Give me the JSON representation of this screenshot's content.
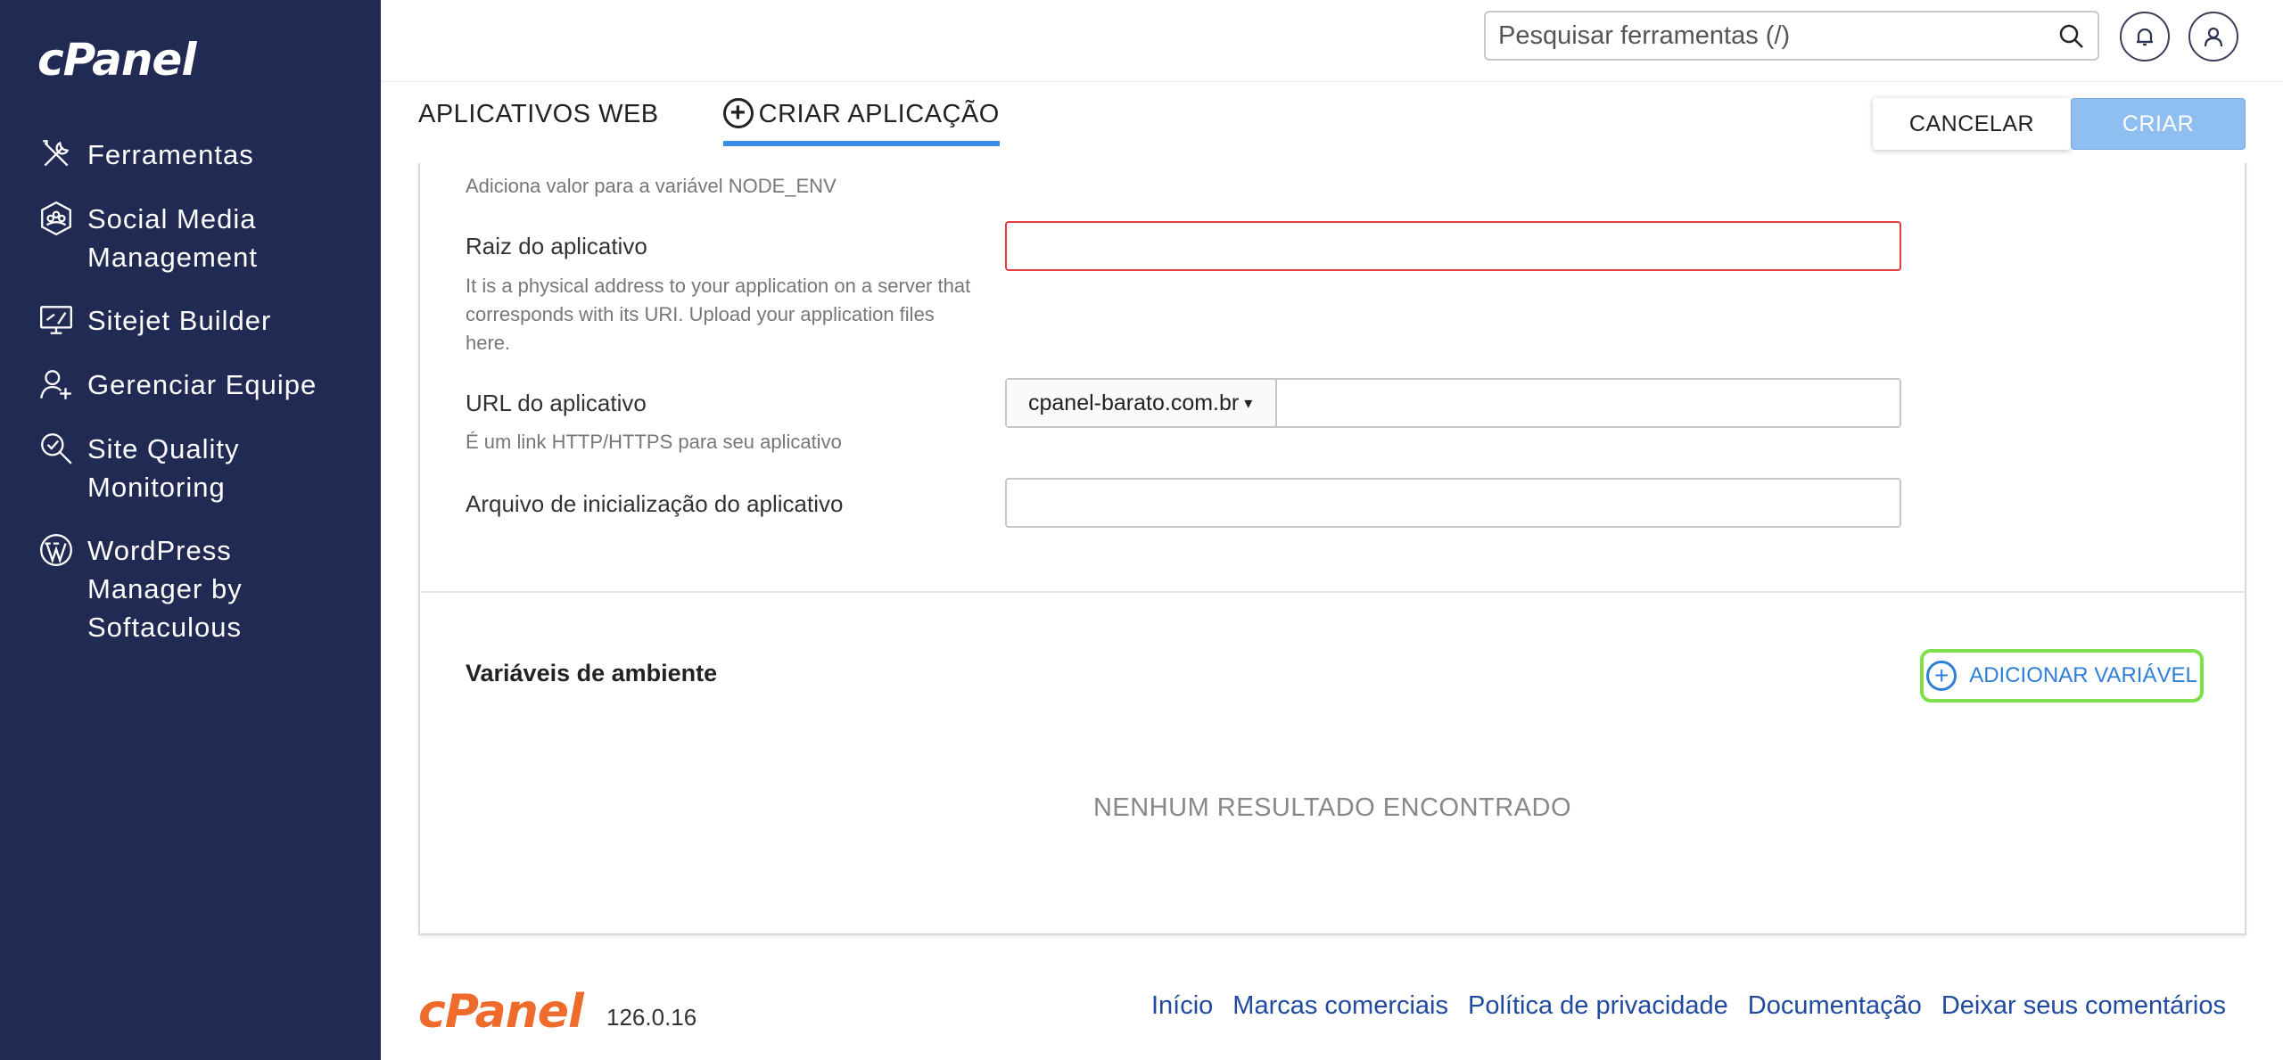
{
  "sidebar": {
    "logo": "cPanel",
    "items": [
      {
        "label": "Ferramentas",
        "icon": "tools-icon"
      },
      {
        "label": "Social Media Management",
        "icon": "social-media-icon"
      },
      {
        "label": "Sitejet Builder",
        "icon": "monitor-icon"
      },
      {
        "label": "Gerenciar Equipe",
        "icon": "user-team-icon"
      },
      {
        "label": "Site Quality Monitoring",
        "icon": "search-check-icon"
      },
      {
        "label": "WordPress Manager by Softaculous",
        "icon": "wordpress-icon"
      }
    ]
  },
  "header": {
    "search_placeholder": "Pesquisar ferramentas (/)"
  },
  "tabs": {
    "web_apps": "APLICATIVOS WEB",
    "create_app": "CRIAR APLICAÇÃO"
  },
  "actions": {
    "cancel": "CANCELAR",
    "create": "CRIAR"
  },
  "form": {
    "node_env_hint": "Adiciona valor para a variável NODE_ENV",
    "root_label": "Raiz do aplicativo",
    "root_hint": "It is a physical address to your application on a server that corresponds with its URI. Upload your application files here.",
    "root_value": "",
    "url_label": "URL do aplicativo",
    "url_hint": "É um link HTTP/HTTPS para seu aplicativo",
    "url_domain": "cpanel-barato.com.br",
    "url_path": "",
    "startup_label": "Arquivo de inicialização do aplicativo",
    "startup_value": ""
  },
  "env": {
    "title": "Variáveis de ambiente",
    "add_button": "ADICIONAR VARIÁVEL",
    "empty": "NENHUM RESULTADO ENCONTRADO"
  },
  "footer": {
    "logo": "cPanel",
    "version": "126.0.16",
    "links": [
      "Início",
      "Marcas comerciais",
      "Política de privacidade",
      "Documentação",
      "Deixar seus comentários"
    ]
  },
  "colors": {
    "sidebar_bg": "#212a52",
    "accent": "#3a8ee6",
    "create_button": "#8fbef0",
    "error_border": "#e63b3b",
    "highlight": "#7ee04a",
    "footer_logo": "#ee6b2b"
  }
}
